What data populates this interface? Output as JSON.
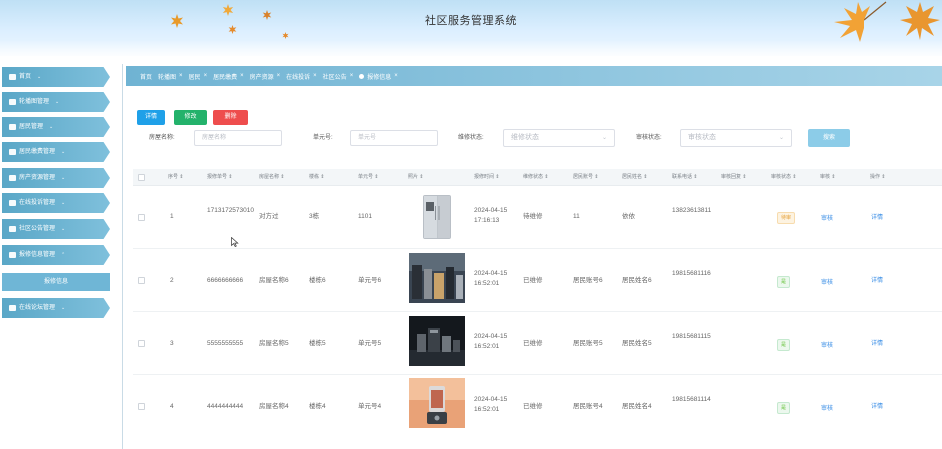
{
  "app": {
    "title": "社区服务管理系统"
  },
  "sidebar": {
    "items": [
      {
        "label": "首页",
        "icon": "home-icon"
      },
      {
        "label": "轮播图管理",
        "icon": "image-icon"
      },
      {
        "label": "居民管理",
        "icon": "user-icon"
      },
      {
        "label": "居民缴费管理",
        "icon": "chart-icon"
      },
      {
        "label": "房产资源管理",
        "icon": "house-icon"
      },
      {
        "label": "在线投诉管理",
        "icon": "message-icon"
      },
      {
        "label": "社区公告管理",
        "icon": "notice-icon"
      },
      {
        "label": "报修信息管理",
        "icon": "tool-icon"
      },
      {
        "label": "在线论坛管理",
        "icon": "forum-icon"
      }
    ],
    "sub_items": [
      {
        "label": "报修信息"
      }
    ]
  },
  "tabs": [
    {
      "label": "首页"
    },
    {
      "label": "轮播图"
    },
    {
      "label": "居民"
    },
    {
      "label": "居民缴费"
    },
    {
      "label": "房产资源"
    },
    {
      "label": "在线投诉"
    },
    {
      "label": "社区公告"
    },
    {
      "label": "报修信息",
      "active": true
    }
  ],
  "toolbar": {
    "detail_label": "详情",
    "edit_label": "修改",
    "delete_label": "删除"
  },
  "search": {
    "room_label": "房屋名称:",
    "room_placeholder": "房屋名称",
    "unit_label": "单元号:",
    "unit_placeholder": "单元号",
    "repair_status_label": "维修状态:",
    "repair_status_placeholder": "维修状态",
    "audit_status_label": "审核状态:",
    "audit_status_placeholder": "审核状态",
    "search_label": "搜索"
  },
  "table": {
    "columns": [
      "序号",
      "报修单号",
      "房屋名称",
      "楼栋",
      "单元号",
      "照片",
      "报修时间",
      "维修状态",
      "居民账号",
      "居民姓名",
      "联系电话",
      "审核回复",
      "审核状态",
      "审核",
      "操作"
    ],
    "sort_mark": "⇕",
    "rows": [
      {
        "no": "1",
        "order": "1713172573010",
        "room": "对方过",
        "building": "3栋",
        "unit": "1101",
        "photo": "fridge",
        "time": "2024-04-15 17:16:13",
        "repair_status": "待维修",
        "account": "11",
        "name": "依依",
        "phone": "13823613811",
        "reply": "",
        "audit_status": "待审",
        "audit": "审核",
        "op": "详情"
      },
      {
        "no": "2",
        "order": "6666666666",
        "room": "房屋名称6",
        "building": "楼栋6",
        "unit": "单元号6",
        "photo": "appliances",
        "time": "2024-04-15 16:52:01",
        "repair_status": "已维修",
        "account": "居民账号6",
        "name": "居民姓名6",
        "phone": "19815681116",
        "reply": "",
        "audit_status": "是",
        "audit": "审核",
        "op": "详情"
      },
      {
        "no": "3",
        "order": "5555555555",
        "room": "房屋名称5",
        "building": "楼栋5",
        "unit": "单元号5",
        "photo": "kitchen",
        "time": "2024-04-15 16:52:01",
        "repair_status": "已维修",
        "account": "居民账号5",
        "name": "居民姓名5",
        "phone": "19815681115",
        "reply": "",
        "audit_status": "是",
        "audit": "审核",
        "op": "详情"
      },
      {
        "no": "4",
        "order": "4444444444",
        "room": "房屋名称4",
        "building": "楼栋4",
        "unit": "单元号4",
        "photo": "blender",
        "time": "2024-04-15 16:52:01",
        "repair_status": "已维修",
        "account": "居民账号4",
        "name": "居民姓名4",
        "phone": "19815681114",
        "reply": "",
        "audit_status": "是",
        "audit": "审核",
        "op": "详情"
      }
    ]
  },
  "colors": {
    "accent": "#5aa7c7",
    "detail": "#1fa0e8",
    "edit": "#23b26b",
    "delete": "#ee4d4d",
    "link": "#3a8ee6"
  }
}
